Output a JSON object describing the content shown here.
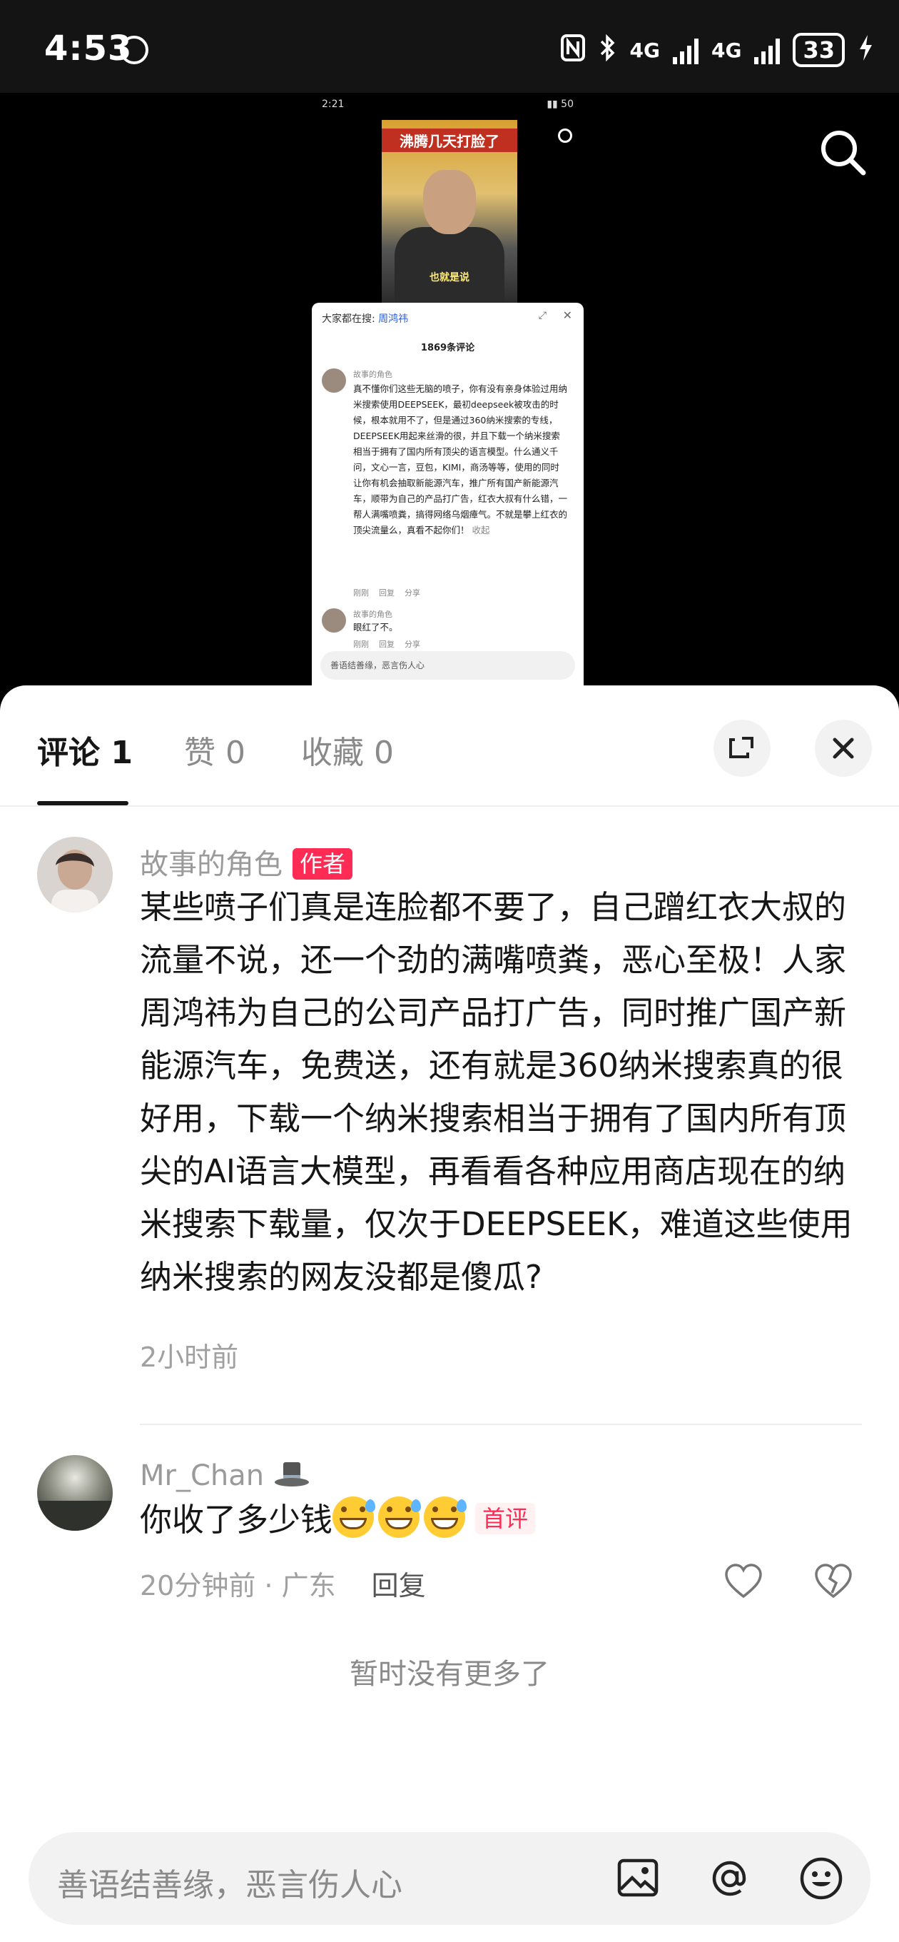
{
  "status_bar": {
    "time": "4:53",
    "battery": "33",
    "network_1": "4G",
    "network_2": "4G"
  },
  "preview": {
    "time": "2:21",
    "video_title": "沸腾几天打脸了",
    "video_caption": "也就是说",
    "search_prefix": "大家都在搜:",
    "search_term": "周鸿祎",
    "comment_count": "1869条评论",
    "comments": [
      {
        "user": "故事的角色",
        "text": "真不懂你们这些无脑的喷子，你有没有亲身体验过用纳米搜索使用DEEPSEEK，最初deepseek被攻击的时候，根本就用不了，但是通过360纳米搜索的专线，DEEPSEEK用起来丝滑的很，并且下载一个纳米搜索相当于拥有了国内所有顶尖的语言模型。什么通义千问，文心一言，豆包，KIMI，商汤等等，使用的同时让你有机会抽取新能源汽车，推广所有国产新能源汽车，顺带为自己的产品打广告，红衣大叔有什么错，一帮人满嘴喷粪，搞得网络乌烟瘴气。不就是攀上红衣的顶尖流量么，真看不起你们！",
        "collapse": "收起",
        "meta": [
          "刚刚",
          "回复",
          "分享"
        ]
      },
      {
        "user": "故事的角色",
        "text": "眼红了不。",
        "meta": [
          "刚刚",
          "回复",
          "分享"
        ]
      }
    ],
    "input_placeholder": "善语结善缘，恶言伤人心"
  },
  "sheet": {
    "tabs": [
      {
        "label": "评论 1",
        "active": true
      },
      {
        "label": "赞 0",
        "active": false
      },
      {
        "label": "收藏 0",
        "active": false
      }
    ],
    "comments": [
      {
        "username": "故事的角色",
        "badge": "作者",
        "text": "某些喷子们真是连脸都不要了，自己蹭红衣大叔的流量不说，还一个劲的满嘴喷粪，恶心至极！人家周鸿祎为自己的公司产品打广告，同时推广国产新能源汽车，免费送，还有就是360纳米搜索真的很好用，下载一个纳米搜索相当于拥有了国内所有顶尖的AI语言大模型，再看看各种应用商店现在的纳米搜索下载量，仅次于DEEPSEEK，难道这些使用纳米搜索的网友没都是傻瓜?",
        "time": "2小时前"
      },
      {
        "username": "Mr_Chan",
        "text": "你收了多少钱",
        "first_badge": "首评",
        "time": "20分钟前 · 广东",
        "reply": "回复"
      }
    ],
    "no_more": "暂时没有更多了",
    "input_placeholder": "善语结善缘，恶言伤人心"
  },
  "colors": {
    "accent": "#fe2c55",
    "status_bar_bg": "#141414"
  },
  "icons": [
    "search-icon",
    "expand-icon",
    "close-icon",
    "heart-icon",
    "dislike-icon",
    "image-icon",
    "at-icon",
    "emoji-icon",
    "hat-icon"
  ]
}
